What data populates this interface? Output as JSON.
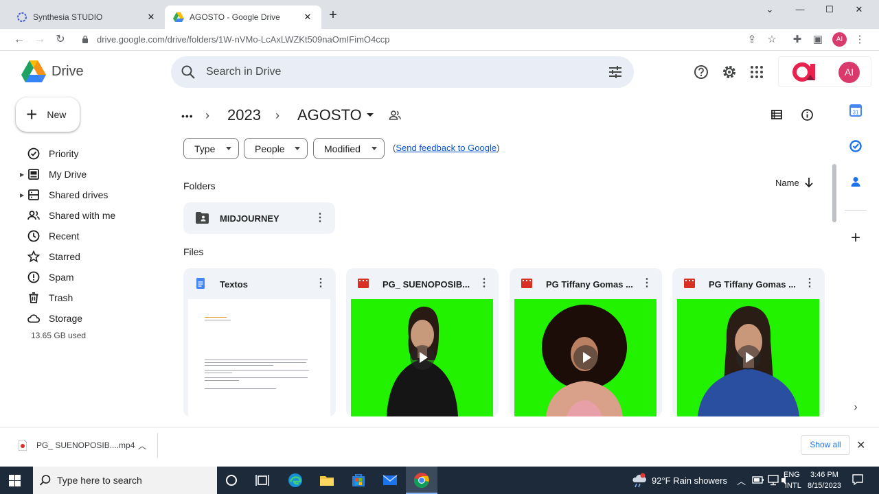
{
  "browser": {
    "tabs": [
      {
        "title": "Synthesia STUDIO",
        "active": false
      },
      {
        "title": "AGOSTO - Google Drive",
        "active": true
      }
    ],
    "new_tab": "+",
    "close_tab": "✕",
    "url": "drive.google.com/drive/folders/1W-nVMo-LcAxLWZKt509naOmIFimO4ccp",
    "profile_initials": "AI"
  },
  "drive": {
    "app_name": "Drive",
    "search_placeholder": "Search in Drive",
    "avatar_initials": "AI",
    "new_button": "New",
    "nav": [
      {
        "label": "Priority"
      },
      {
        "label": "My Drive"
      },
      {
        "label": "Shared drives"
      },
      {
        "label": "Shared with me"
      },
      {
        "label": "Recent"
      },
      {
        "label": "Starred"
      },
      {
        "label": "Spam"
      },
      {
        "label": "Trash"
      },
      {
        "label": "Storage"
      }
    ],
    "storage_used": "13.65 GB used",
    "breadcrumb": {
      "ellipsis": "•••",
      "parent": "2023",
      "current": "AGOSTO"
    },
    "filters": [
      "Type",
      "People",
      "Modified"
    ],
    "feedback": {
      "open": "(",
      "link": "Send feedback to Google",
      "close": ")"
    },
    "sort": {
      "label": "Name",
      "direction": "descending"
    },
    "folders_title": "Folders",
    "folders": [
      {
        "name": "MIDJOURNEY"
      }
    ],
    "files_title": "Files",
    "files": [
      {
        "name": "Textos",
        "type": "doc"
      },
      {
        "name": "PG_ SUENOPOSIB...",
        "type": "video"
      },
      {
        "name": "PG Tiffany Gomas ...",
        "type": "video"
      },
      {
        "name": "PG Tiffany Gomas ...",
        "type": "video"
      }
    ]
  },
  "download_bar": {
    "file": "PG_ SUENOPOSIB....mp4",
    "show_all": "Show all"
  },
  "taskbar": {
    "search_placeholder": "Type here to search",
    "weather": "92°F  Rain showers",
    "lang_top": "ENG",
    "lang_bottom": "INTL",
    "time": "3:46 PM",
    "date": "8/15/2023"
  },
  "colors": {
    "accent": "#0b57d0",
    "search_bg": "#e9eef6",
    "card_bg": "#f0f4f9",
    "green_screen": "#22f200",
    "video_icon": "#d93025",
    "doc_icon": "#4285f4",
    "avatar": "#d93a6b"
  }
}
